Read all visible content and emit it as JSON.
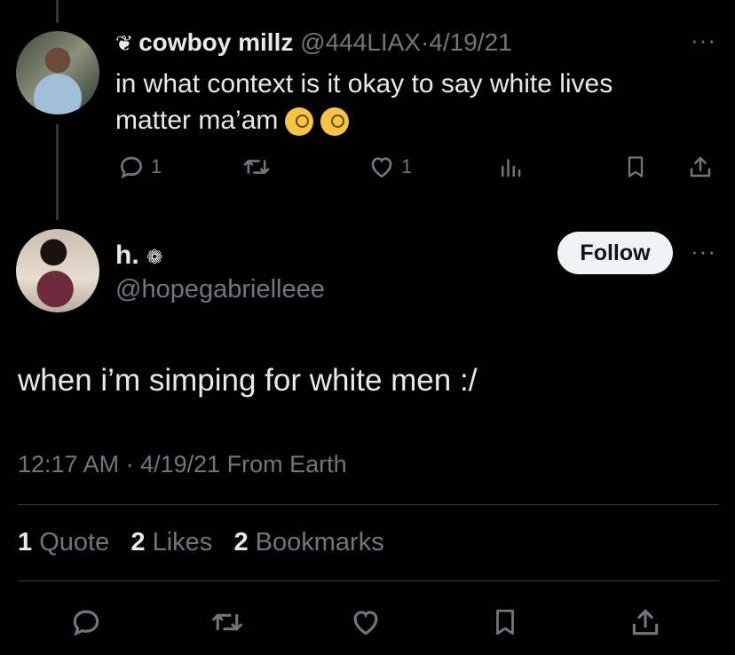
{
  "reply_to": {
    "badge_glyph": "❦",
    "display_name": "cowboy millz",
    "handle": "@444LIAX",
    "separator": "·",
    "date": "4/19/21",
    "text": "in what context is it okay to say white lives matter ma’am",
    "more": "···",
    "reply_count": "1",
    "like_count": "1"
  },
  "main_tweet": {
    "display_name": "h.",
    "name_badge": "❁",
    "handle": "@hopegabrielleee",
    "follow_label": "Follow",
    "more": "···",
    "text": "when i’m simping for white men :/",
    "timestamp": "12:17 AM · 4/19/21 From Earth",
    "stats": {
      "quotes_num": "1",
      "quotes_label": "Quote",
      "likes_num": "2",
      "likes_label": "Likes",
      "bookmarks_num": "2",
      "bookmarks_label": "Bookmarks"
    }
  },
  "colors": {
    "background": "#000000",
    "text": "#e7e9ea",
    "muted": "#71767b",
    "divider": "#2f3336",
    "follow_bg": "#eff3f4"
  },
  "icons": [
    "reply-icon",
    "retweet-icon",
    "like-icon",
    "views-icon",
    "bookmark-icon",
    "share-icon",
    "monocle-emoji"
  ]
}
